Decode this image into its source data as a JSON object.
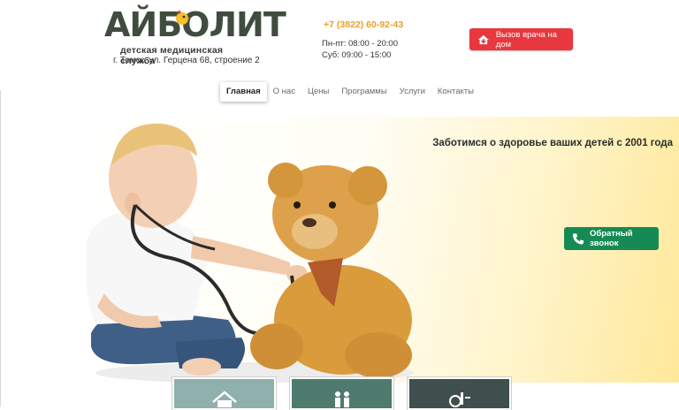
{
  "brand": {
    "name": "АЙБОЛИТ",
    "tagline": "детская медицинская служба",
    "address": "г. Томск, ул. Герцена 68, строение 2"
  },
  "contacts": {
    "phone": "+7 (3822) 60-92-43",
    "hours_weekdays": "Пн-пт: 08:00 - 20:00",
    "hours_saturday": "Суб: 09:00 - 15:00"
  },
  "header": {
    "call_doctor_label": "Вызов врача на дом"
  },
  "nav": {
    "items": [
      {
        "label": "Главная",
        "active": true
      },
      {
        "label": "О нас",
        "active": false
      },
      {
        "label": "Цены",
        "active": false
      },
      {
        "label": "Программы",
        "active": false
      },
      {
        "label": "Услуги",
        "active": false
      },
      {
        "label": "Контакты",
        "active": false
      }
    ]
  },
  "hero": {
    "title": "Заботимся о здоровье ваших детей с 2001 года",
    "callback_label": "Обратный звонок"
  },
  "icons": {
    "call_doctor": "house-plus-icon",
    "callback": "phone-icon",
    "tile_1": "home-icon",
    "tile_2": "family-icon",
    "tile_3": "microscope-icon"
  },
  "colors": {
    "accent_red": "#e8373e",
    "accent_green": "#168a55",
    "phone_orange": "#e8a02c",
    "tile_1": "#8fb0ad",
    "tile_2": "#4f7b6e",
    "tile_3": "#3e4f4d"
  }
}
